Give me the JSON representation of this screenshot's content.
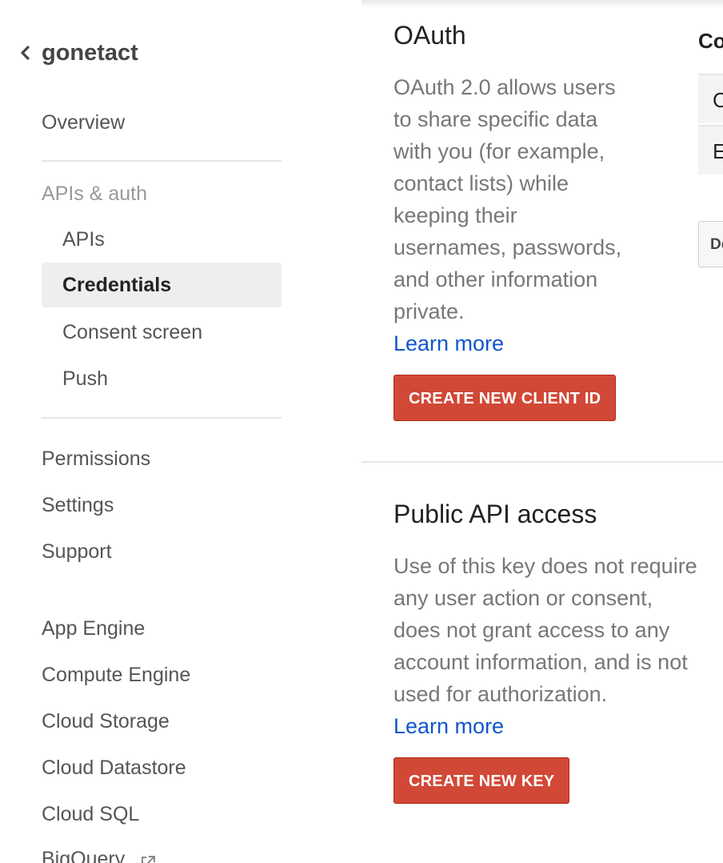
{
  "sidebar": {
    "project_name": "gonetact",
    "items": [
      {
        "label": "Overview"
      },
      {
        "label": "APIs & auth"
      },
      {
        "label": "APIs"
      },
      {
        "label": "Credentials"
      },
      {
        "label": "Consent screen"
      },
      {
        "label": "Push"
      },
      {
        "label": "Permissions"
      },
      {
        "label": "Settings"
      },
      {
        "label": "Support"
      },
      {
        "label": "App Engine"
      },
      {
        "label": "Compute Engine"
      },
      {
        "label": "Cloud Storage"
      },
      {
        "label": "Cloud Datastore"
      },
      {
        "label": "Cloud SQL"
      },
      {
        "label": "BigQuery"
      }
    ],
    "active_item": "Credentials"
  },
  "oauth": {
    "title": "OAuth",
    "description_lines": [
      "OAuth 2.0 allows users",
      "to share specific data",
      "with you (for example,",
      "contact lists) while",
      "keeping their",
      "usernames, passwords,",
      "and other information",
      "private."
    ],
    "learn_more": "Learn more",
    "button": "CREATE NEW CLIENT ID"
  },
  "public_api": {
    "title": "Public API access",
    "description_lines": [
      "Use of this key does not require",
      "any user action or consent,",
      "does not grant access to any",
      "account information, and is not",
      "used for authorization."
    ],
    "learn_more": "Learn more",
    "button": "CREATE NEW KEY"
  },
  "right_panel": {
    "heading": "Co",
    "rows": [
      "C",
      "E"
    ],
    "button": "De"
  },
  "colors": {
    "accent_button": "#d14836",
    "link": "#1155cc",
    "active_bg": "#eeeeee"
  }
}
